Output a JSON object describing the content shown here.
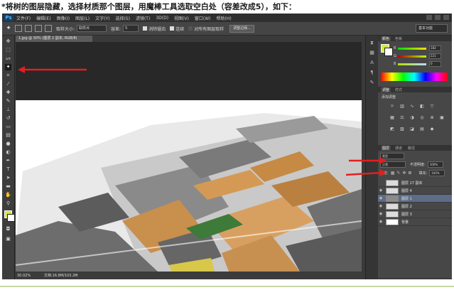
{
  "caption": "*将树的图层隐藏，选择材质那个图层，用魔棒工具选取空白处（容差改成5），如下：",
  "app": {
    "logo": "Ps",
    "menu": [
      "文件(F)",
      "编辑(E)",
      "图像(I)",
      "图层(L)",
      "文字(Y)",
      "选择(S)",
      "滤镜(T)",
      "3D(D)",
      "视图(V)",
      "窗口(W)",
      "帮助(H)"
    ]
  },
  "options_bar": {
    "sample_size_label": "取样大小:",
    "sample_size_value": "取样点",
    "tolerance_label": "容差:",
    "tolerance_value": "5",
    "antialias_label": "消除锯齿",
    "contiguous_label": "连续",
    "sample_all_layers_label": "对所有图层取样",
    "refine_edge_label": "调整边缘...",
    "workspace": "基本功能"
  },
  "document": {
    "tab_title": "1.jpg @ 30% (图层 2 副本, RGB/8)",
    "zoom": "30.02%",
    "doc_info": "文档:16.8M/103.2M"
  },
  "color_panel": {
    "tabs": [
      "颜色",
      "色板"
    ],
    "r": "182",
    "g": "221",
    "b": "0"
  },
  "adjustments_panel": {
    "tabs": [
      "调整",
      "样式"
    ],
    "title": "添加调整"
  },
  "layers_panel": {
    "tabs": [
      "图层",
      "通道",
      "路径"
    ],
    "kind_label": "类型",
    "blend_mode": "正常",
    "opacity_label": "不透明度:",
    "opacity": "100%",
    "lock_label": "锁定:",
    "fill_label": "填充:",
    "fill": "100%",
    "layers": [
      {
        "name": "图层 17 副本",
        "visible": false,
        "selected": false
      },
      {
        "name": "图层 4",
        "visible": true,
        "selected": false
      },
      {
        "name": "图层 1",
        "visible": true,
        "selected": true
      },
      {
        "name": "图层 2",
        "visible": true,
        "selected": false
      },
      {
        "name": "图层 3",
        "visible": true,
        "selected": false
      },
      {
        "name": "背景",
        "visible": true,
        "selected": false
      }
    ]
  },
  "colors": {
    "foreground": "#d7e83a",
    "background": "#ffffff",
    "annotation_arrow": "#e02020",
    "selected_layer": "#5d6d88"
  }
}
